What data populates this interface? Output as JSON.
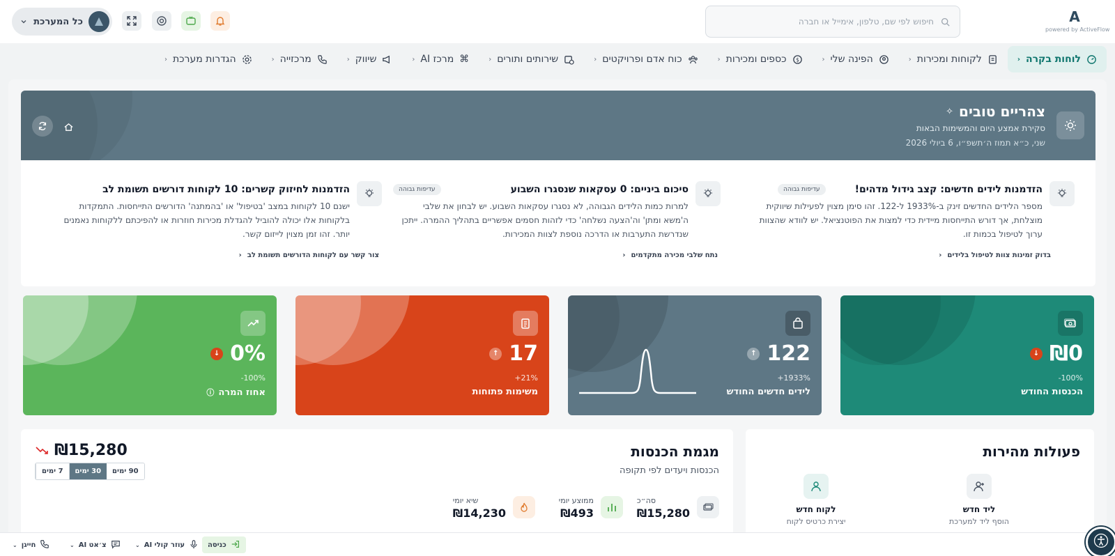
{
  "brand": {
    "logo_mark": "A",
    "tagline": "powered by ActiveFlow"
  },
  "search": {
    "placeholder": "חיפוש לפי שם, טלפון, אימייל או חברה"
  },
  "user_menu": {
    "label": "כל המערכת"
  },
  "nav": [
    {
      "label": "לוחות בקרה",
      "icon": "dashboard-icon"
    },
    {
      "label": "לקוחות ומכירות",
      "icon": "contacts-icon"
    },
    {
      "label": "הפינה שלי",
      "icon": "user-circle-icon"
    },
    {
      "label": "כספים ומכירות",
      "icon": "dollar-icon"
    },
    {
      "label": "כוח אדם ופרויקטים",
      "icon": "team-icon"
    },
    {
      "label": "שירותים ותורים",
      "icon": "calendar-clock-icon"
    },
    {
      "label": "מרכז AI",
      "icon": "command-icon"
    },
    {
      "label": "שיווק",
      "icon": "megaphone-icon"
    },
    {
      "label": "מרכזייה",
      "icon": "phone-icon"
    },
    {
      "label": "הגדרות מערכת",
      "icon": "settings-icon"
    }
  ],
  "banner": {
    "greeting": "צהריים טובים",
    "subtitle": "סקירת אמצע היום והמשימות הבאות",
    "date": "שני, כ״א תמוז ה׳תשפ״ו, 6 ביולי 2026"
  },
  "insights": [
    {
      "title": "הזדמנות לידים חדשים: קצב גידול מדהים!",
      "badge": "עדיפות גבוהה",
      "desc": "מספר הלידים החדשים זינק ב-1933% ל-122. זהו סימן מצוין לפעילות שיווקית מוצלחת, אך דורש התייחסות מיידית כדי למצות את הפוטנציאל. יש לוודא שהצוות ערוך לטיפול בכמות זו.",
      "link": "בדוק זמינות צוות לטיפול בלידים"
    },
    {
      "title": "סיכום ביניים: 0 עסקאות שנסגרו השבוע",
      "badge": "עדיפות גבוהה",
      "desc": "למרות כמות הלידים הגבוהה, לא נסגרו עסקאות השבוע. יש לבחון את שלבי ה'משא ומתן' וה'הצעה נשלחה' כדי לזהות חסמים אפשריים בתהליך ההמרה. ייתכן שנדרשת התערבות או הדרכה נוספת לצוות המכירות.",
      "link": "נתח שלבי מכירה מתקדמים"
    },
    {
      "title": "הזדמנות לחיזוק קשרים: 10 לקוחות דורשים תשומת לב",
      "badge": "",
      "desc": "ישנם 10 לקוחות במצב 'בטיפול' או 'בהמתנה' הדורשים התייחסות. התמקדות בלקוחות אלו יכולה להוביל להגדלת מכירות חוזרות או להפיכתם ללקוחות נאמנים יותר. זהו זמן מצוין לייזום קשר.",
      "link": "צור קשר עם לקוחות הדורשים תשומת לב"
    }
  ],
  "kpis": [
    {
      "value": "₪0",
      "change": "-100%",
      "label": "הכנסות החודש",
      "color": "#1e8a78",
      "icon": "money-icon",
      "trend": "down"
    },
    {
      "value": "122",
      "change": "+1933%",
      "label": "לידים חדשים החודש",
      "color": "#5e7785",
      "icon": "shopping-bag-icon",
      "trend": "up"
    },
    {
      "value": "17",
      "change": "+21%",
      "label": "משימות פתוחות",
      "color": "#d8441a",
      "icon": "clipboard-icon",
      "trend": "up"
    },
    {
      "value": "0%",
      "change": "-100%",
      "label": "אחוז המרה",
      "color": "#5bb55b",
      "icon": "trend-up-icon",
      "trend": "down"
    }
  ],
  "quick_actions": {
    "title": "פעולות מהירות",
    "items": [
      {
        "title": "ליד חדש",
        "sub": "הוסף ליד למערכת"
      },
      {
        "title": "לקוח חדש",
        "sub": "יצירת כרטיס לקוח"
      }
    ]
  },
  "income": {
    "title": "מגמת הכנסות",
    "subtitle": "הכנסות ויעדים לפי תקופה",
    "total": "₪15,280",
    "ranges": [
      "7 ימים",
      "30 ימים",
      "90 ימים"
    ],
    "active_range": "30 ימים",
    "stats": [
      {
        "label": "סה״כ",
        "value": "₪15,280"
      },
      {
        "label": "ממוצע יומי",
        "value": "₪493"
      },
      {
        "label": "שיא יומי",
        "value": "₪14,230"
      }
    ]
  },
  "bottom": {
    "entry": "כניסה",
    "voice": "עוזר קולי AI",
    "chat": "צ׳אט AI",
    "dialer": "חייגן"
  },
  "colors": {
    "accent": "#0f766e",
    "slate": "#5e7785",
    "green": "#5bb55b",
    "orange": "#d8441a",
    "teal": "#1e8a78"
  }
}
